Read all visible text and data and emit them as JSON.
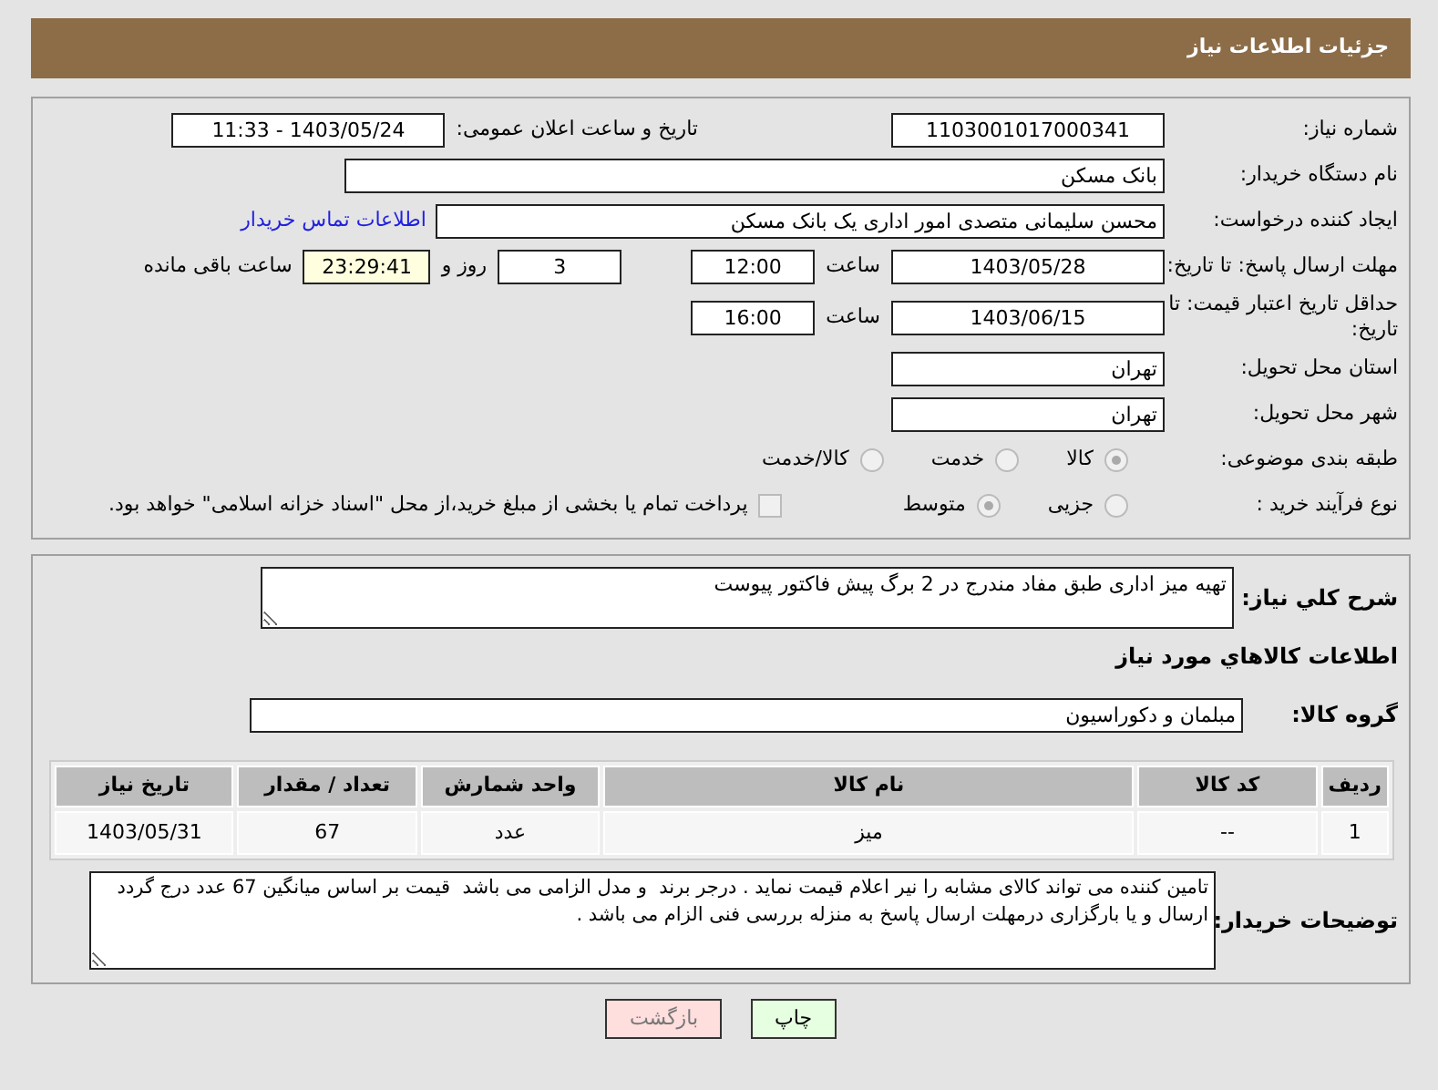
{
  "header": {
    "title": "جزئیات اطلاعات نیاز"
  },
  "need_number": {
    "label": "شماره نیاز:",
    "value": "1103001017000341"
  },
  "announce": {
    "label": "تاریخ و ساعت اعلان عمومی:",
    "value": "1403/05/24 - 11:33"
  },
  "buyer": {
    "label": "نام دستگاه خریدار:",
    "value": "بانک مسکن"
  },
  "creator": {
    "label": "ایجاد کننده درخواست:",
    "value": "محسن سلیمانی متصدی امور اداری یک بانک مسکن",
    "link": "اطلاعات تماس خریدار"
  },
  "reply_deadline": {
    "label": "مهلت ارسال پاسخ: تا تاریخ:",
    "date": "1403/05/28",
    "time_label": "ساعت",
    "time": "12:00",
    "days": "3",
    "days_label": "روز و",
    "remaining": "23:29:41",
    "remaining_label": "ساعت باقی مانده"
  },
  "price_validity": {
    "label": "حداقل تاریخ اعتبار قیمت: تا تاریخ:",
    "date": "1403/06/15",
    "time_label": "ساعت",
    "time": "16:00"
  },
  "province": {
    "label": "استان محل تحویل:",
    "value": "تهران"
  },
  "city": {
    "label": "شهر محل تحویل:",
    "value": "تهران"
  },
  "category": {
    "label": "طبقه بندی موضوعی:",
    "options": [
      {
        "label": "کالا",
        "selected": true
      },
      {
        "label": "خدمت",
        "selected": false
      },
      {
        "label": "کالا/خدمت",
        "selected": false
      }
    ]
  },
  "process": {
    "label": "نوع فرآیند خرید :",
    "options": [
      {
        "label": "جزیی",
        "selected": false
      },
      {
        "label": "متوسط",
        "selected": true
      }
    ],
    "treasury": {
      "label": "پرداخت تمام یا بخشی از مبلغ خرید،از محل \"اسناد خزانه اسلامی\" خواهد بود.",
      "checked": false
    }
  },
  "description": {
    "label": "شرح کلي نياز:",
    "value": "تهیه میز اداری طبق مفاد مندرج در 2 برگ پیش فاکتور پیوست"
  },
  "goods_heading": "اطلاعات كالاهاي مورد نياز",
  "goods_group": {
    "label": "گروه کالا:",
    "value": "مبلمان و دکوراسیون"
  },
  "table": {
    "columns": [
      "ردیف",
      "کد کالا",
      "نام کالا",
      "واحد شمارش",
      "تعداد / مقدار",
      "تاریخ نیاز"
    ],
    "rows": [
      [
        "1",
        "--",
        "میز",
        "عدد",
        "67",
        "1403/05/31"
      ]
    ]
  },
  "buyer_notes": {
    "label": "توضیحات خریدار:",
    "value": "تامین کننده می تواند کالای مشابه را نیر اعلام قیمت نماید . درجر برند  و مدل الزامی می باشد  قیمت بر اساس میانگین 67 عدد درج گردد ارسال و یا بارگزاری درمهلت ارسال پاسخ به منزله بررسی فنی الزام می باشد ."
  },
  "buttons": [
    {
      "label": "چاپ",
      "kind": "print"
    },
    {
      "label": "بازگشت",
      "kind": "back"
    }
  ]
}
